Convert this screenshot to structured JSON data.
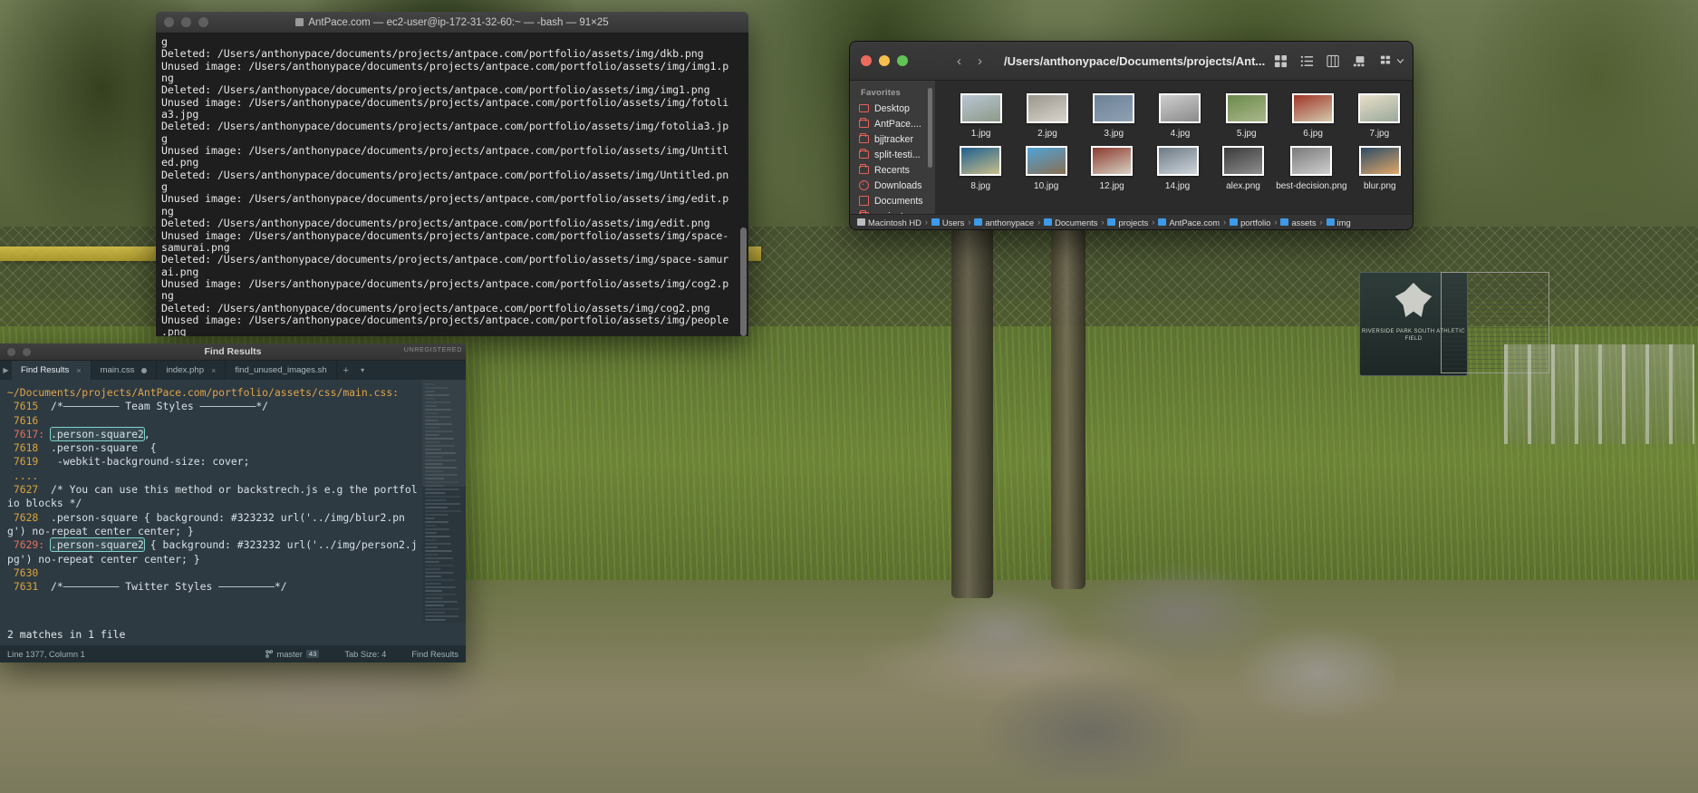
{
  "desktop": {
    "sign_text": "RIVERSIDE PARK SOUTH ATHLETIC FIELD"
  },
  "terminal": {
    "title": "AntPace.com — ec2-user@ip-172-31-32-60:~ — -bash — 91×25",
    "icon": "terminal-icon",
    "window_controls": [
      "close",
      "minimize",
      "zoom"
    ],
    "lines": [
      "g",
      "Deleted: /Users/anthonypace/documents/projects/antpace.com/portfolio/assets/img/dkb.png",
      "Unused image: /Users/anthonypace/documents/projects/antpace.com/portfolio/assets/img/img1.p",
      "ng",
      "Deleted: /Users/anthonypace/documents/projects/antpace.com/portfolio/assets/img/img1.png",
      "Unused image: /Users/anthonypace/documents/projects/antpace.com/portfolio/assets/img/fotoli",
      "a3.jpg",
      "Deleted: /Users/anthonypace/documents/projects/antpace.com/portfolio/assets/img/fotolia3.jp",
      "g",
      "Unused image: /Users/anthonypace/documents/projects/antpace.com/portfolio/assets/img/Untitl",
      "ed.png",
      "Deleted: /Users/anthonypace/documents/projects/antpace.com/portfolio/assets/img/Untitled.pn",
      "g",
      "Unused image: /Users/anthonypace/documents/projects/antpace.com/portfolio/assets/img/edit.p",
      "ng",
      "Deleted: /Users/anthonypace/documents/projects/antpace.com/portfolio/assets/img/edit.png",
      "Unused image: /Users/anthonypace/documents/projects/antpace.com/portfolio/assets/img/space-",
      "samurai.png",
      "Deleted: /Users/anthonypace/documents/projects/antpace.com/portfolio/assets/img/space-samur",
      "ai.png",
      "Unused image: /Users/anthonypace/documents/projects/antpace.com/portfolio/assets/img/cog2.p",
      "ng",
      "Deleted: /Users/anthonypace/documents/projects/antpace.com/portfolio/assets/img/cog2.png",
      "Unused image: /Users/anthonypace/documents/projects/antpace.com/portfolio/assets/img/people",
      ".png"
    ]
  },
  "finder": {
    "window_controls": [
      "close",
      "minimize",
      "zoom"
    ],
    "back_icon": "chevron-left-icon",
    "forward_icon": "chevron-right-icon",
    "path_title": "/Users/anthonypace/Documents/projects/Ant...",
    "toolbar_icons": [
      "icon-view-icon",
      "list-view-icon",
      "column-view-icon",
      "gallery-view-icon",
      "group-by-icon",
      "chevron-down-icon",
      "share-icon",
      "tag-icon",
      "action-icon",
      "chevron-down-small-icon",
      "search-icon"
    ],
    "sidebar": {
      "header": "Favorites",
      "items": [
        {
          "label": "Desktop",
          "icon": "desktop-icon"
        },
        {
          "label": "AntPace....",
          "icon": "folder-icon"
        },
        {
          "label": "bjjtracker",
          "icon": "folder-icon"
        },
        {
          "label": "split-testi...",
          "icon": "folder-icon"
        },
        {
          "label": "Recents",
          "icon": "folder-icon"
        },
        {
          "label": "Downloads",
          "icon": "downloads-icon"
        },
        {
          "label": "Documents",
          "icon": "document-icon"
        },
        {
          "label": "projects",
          "icon": "folder-icon"
        }
      ]
    },
    "files_row1": [
      {
        "name": "1.jpg",
        "c1": "#b9c6d4",
        "c2": "#8d9a88"
      },
      {
        "name": "2.jpg",
        "c1": "#9a958d",
        "c2": "#d9d4cc"
      },
      {
        "name": "3.jpg",
        "c1": "#6d8196",
        "c2": "#8fa2b4"
      },
      {
        "name": "4.jpg",
        "c1": "#cfcfcf",
        "c2": "#8a8a8a"
      },
      {
        "name": "5.jpg",
        "c1": "#6b8a4a",
        "c2": "#aab88c"
      },
      {
        "name": "6.jpg",
        "c1": "#a03527",
        "c2": "#d4c9ae"
      },
      {
        "name": "7.jpg",
        "c1": "#e8dfc9",
        "c2": "#9aa89a"
      }
    ],
    "files_row2": [
      {
        "name": "8.jpg",
        "c1": "#1f5f8f",
        "c2": "#c9bf8a"
      },
      {
        "name": "10.jpg",
        "c1": "#4fa3d8",
        "c2": "#8a6f52"
      },
      {
        "name": "12.jpg",
        "c1": "#8c3a2e",
        "c2": "#d8d2c4"
      },
      {
        "name": "14.jpg",
        "c1": "#6d7a84",
        "c2": "#cfd6dc"
      },
      {
        "name": "alex.png",
        "c1": "#3a3a3a",
        "c2": "#8f8f8f"
      },
      {
        "name": "best-decision.png",
        "c1": "#7a7a7a",
        "c2": "#cfcfcf"
      },
      {
        "name": "blur.png",
        "c1": "#2c4b66",
        "c2": "#e0a86a"
      }
    ],
    "breadcrumbs": [
      {
        "label": "Macintosh HD",
        "icon": "harddisk-icon"
      },
      {
        "label": "Users",
        "icon": "folder-icon"
      },
      {
        "label": "anthonypace",
        "icon": "home-folder-icon"
      },
      {
        "label": "Documents",
        "icon": "folder-icon"
      },
      {
        "label": "projects",
        "icon": "folder-icon"
      },
      {
        "label": "AntPace.com",
        "icon": "folder-icon"
      },
      {
        "label": "portfolio",
        "icon": "folder-icon"
      },
      {
        "label": "assets",
        "icon": "folder-icon"
      },
      {
        "label": "img",
        "icon": "folder-icon"
      }
    ],
    "breadcrumb_separator": "›"
  },
  "sublime": {
    "window_title": "Find Results",
    "unregistered_label": "UNREGISTERED",
    "window_controls": [
      "close",
      "minimize"
    ],
    "tab_scroll_icon": "play-right-icon",
    "tabs": [
      {
        "label": "Find Results",
        "active": true,
        "close": "×",
        "modified": false
      },
      {
        "label": "main.css",
        "active": false,
        "close": "",
        "modified": true
      },
      {
        "label": "index.php",
        "active": false,
        "close": "×",
        "modified": false
      },
      {
        "label": "find_unused_images.sh",
        "active": false,
        "close": "",
        "modified": false
      }
    ],
    "tab_add_icon": "+",
    "tab_menu_icon": "▾",
    "results_header": "~/Documents/projects/AntPace.com/portfolio/assets/css/main.css:",
    "code_lines": [
      {
        "num": "7615",
        "sep": " ",
        "text": "/*————————— Team Styles —————————*/",
        "hl": false
      },
      {
        "num": "7616",
        "sep": " ",
        "text": "",
        "hl": false
      },
      {
        "num": "7617",
        "sep": ":",
        "text": ".person-square2,",
        "hl": true,
        "match": ".person-square2"
      },
      {
        "num": "7618",
        "sep": " ",
        "text": ".person-square  {",
        "hl": false
      },
      {
        "num": "7619",
        "sep": " ",
        "text": " -webkit-background-size: cover;",
        "hl": false
      },
      {
        "num": "....",
        "sep": "",
        "text": "",
        "hl": false
      },
      {
        "num": "7627",
        "sep": " ",
        "text": "/* You can use this method or backstrech.js e.g the portfolio blocks */",
        "hl": false
      },
      {
        "num": "7628",
        "sep": " ",
        "text": ".person-square { background: #323232 url('../img/blur2.png') no-repeat center center; }",
        "hl": false
      },
      {
        "num": "7629",
        "sep": ":",
        "text": ".person-square2 { background: #323232 url('../img/person2.jpg') no-repeat center center; }",
        "hl": true,
        "match": ".person-square2"
      },
      {
        "num": "7630",
        "sep": " ",
        "text": "",
        "hl": false
      },
      {
        "num": "7631",
        "sep": " ",
        "text": "/*————————— Twitter Styles —————————*/",
        "hl": false
      }
    ],
    "match_summary": "2 matches in 1 file",
    "status": {
      "position": "Line 1377, Column 1",
      "branch_icon": "branch-icon",
      "branch": "master",
      "branch_count": "43",
      "tab_size": "Tab Size: 4",
      "syntax": "Find Results"
    }
  }
}
